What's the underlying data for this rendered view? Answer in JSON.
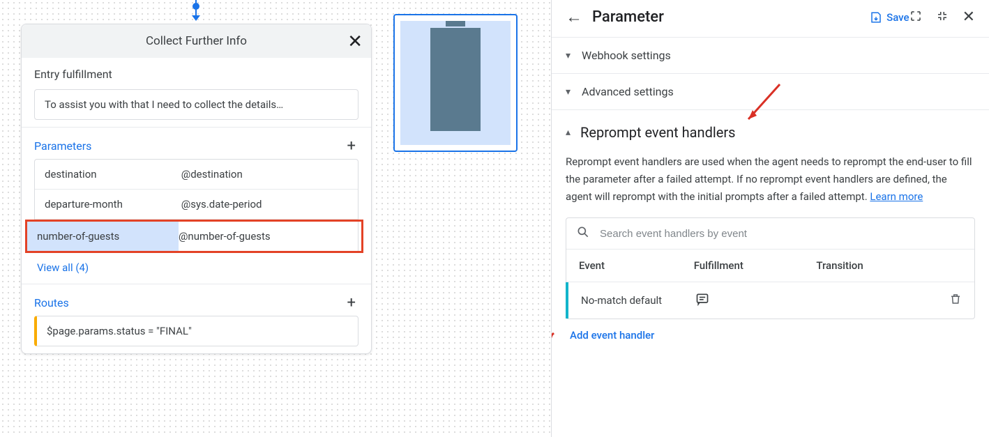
{
  "left": {
    "card_title": "Collect Further Info",
    "entry_fulfillment_label": "Entry fulfillment",
    "entry_fulfillment_text": "To assist you with that I need to collect the details…",
    "parameters_label": "Parameters",
    "parameters": [
      {
        "name": "destination",
        "entity": "@destination"
      },
      {
        "name": "departure-month",
        "entity": "@sys.date-period"
      },
      {
        "name": "number-of-guests",
        "entity": "@number-of-guests"
      }
    ],
    "view_all": "View all (4)",
    "routes_label": "Routes",
    "route_condition": "$page.params.status = \"FINAL\""
  },
  "right": {
    "title": "Parameter",
    "save_label": "Save",
    "webhook_settings": "Webhook settings",
    "advanced_settings": "Advanced settings",
    "reprompt_title": "Reprompt event handlers",
    "reprompt_desc": "Reprompt event handlers are used when the agent needs to reprompt the end-user to fill the parameter after a failed attempt. If no reprompt event handlers are defined, the agent will reprompt with the initial prompts after a failed attempt. ",
    "learn_more": "Learn more",
    "search_placeholder": "Search event handlers by event",
    "col_event": "Event",
    "col_fulfillment": "Fulfillment",
    "col_transition": "Transition",
    "row_event": "No-match default",
    "add_handler": "Add event handler"
  }
}
